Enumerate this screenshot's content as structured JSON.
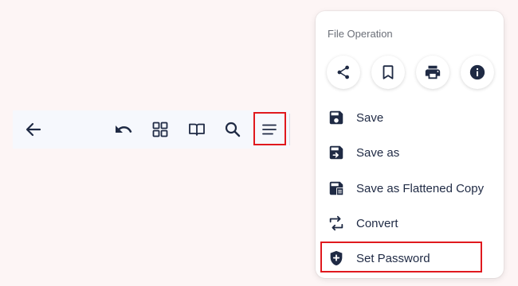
{
  "colors": {
    "background": "#fdf5f5",
    "toolbar_bg": "#f6f8fd",
    "icon_dark": "#1f2a44",
    "highlight_red": "#e0191e"
  },
  "toolbar": {
    "icons": [
      "back-arrow-icon",
      "undo-icon",
      "grid-icon",
      "book-icon",
      "search-icon",
      "menu-icon"
    ]
  },
  "panel": {
    "title": "File Operation",
    "quick_actions": [
      "share-icon",
      "bookmark-icon",
      "print-icon",
      "info-icon"
    ],
    "items": [
      {
        "label": "Save",
        "icon": "save-icon"
      },
      {
        "label": "Save as",
        "icon": "save-as-icon"
      },
      {
        "label": "Save as Flattened Copy",
        "icon": "save-flattened-icon"
      },
      {
        "label": "Convert",
        "icon": "convert-icon"
      },
      {
        "label": "Set Password",
        "icon": "shield-plus-icon"
      }
    ]
  }
}
